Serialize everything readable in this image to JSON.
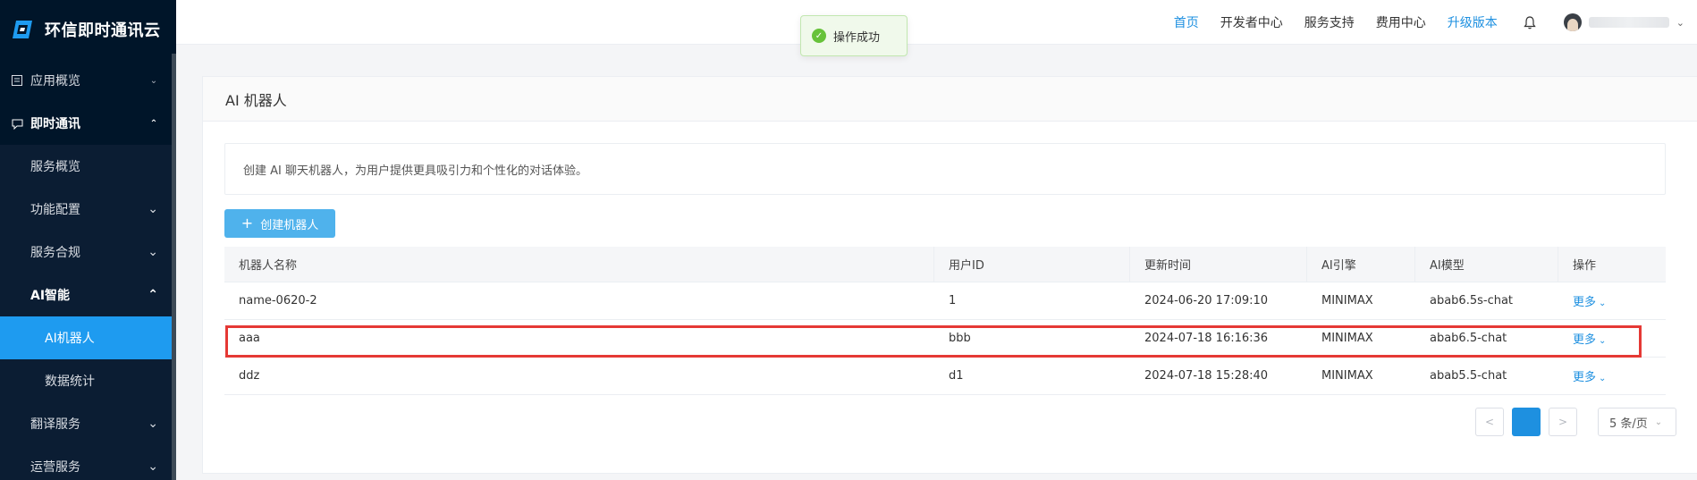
{
  "brand": {
    "name": "环信即时通讯云"
  },
  "sidebar": {
    "items": [
      {
        "label": "应用概览",
        "icon": "overview-icon",
        "state": "collapsed"
      },
      {
        "label": "即时通讯",
        "icon": "chat-icon",
        "state": "expanded"
      }
    ],
    "im_children": [
      {
        "label": "服务概览"
      },
      {
        "label": "功能配置"
      },
      {
        "label": "服务合规"
      },
      {
        "label": "AI智能"
      }
    ],
    "ai_children": [
      {
        "label": "AI机器人",
        "active": true
      },
      {
        "label": "数据统计"
      }
    ],
    "after": [
      {
        "label": "翻译服务"
      },
      {
        "label": "运营服务"
      }
    ]
  },
  "header": {
    "nav": [
      {
        "label": "首页",
        "accent": true
      },
      {
        "label": "开发者中心",
        "accent": false
      },
      {
        "label": "服务支持",
        "accent": false
      },
      {
        "label": "费用中心",
        "accent": false
      },
      {
        "label": "升级版本",
        "accent": true
      }
    ]
  },
  "toast": {
    "text": "操作成功",
    "icon": "check-circle-icon"
  },
  "card": {
    "title": "AI 机器人",
    "tip": "创建 AI 聊天机器人，为用户提供更具吸引力和个性化的对话体验。",
    "create_button": "创建机器人"
  },
  "table": {
    "columns": [
      "机器人名称",
      "用户ID",
      "更新时间",
      "AI引擎",
      "AI模型",
      "操作"
    ],
    "rows": [
      {
        "name": "name-0620-2",
        "user_id": "1",
        "updated": "2024-06-20 17:09:10",
        "engine": "MINIMAX",
        "model": "abab6.5s-chat",
        "action": "更多"
      },
      {
        "name": "aaa",
        "user_id": "bbb",
        "updated": "2024-07-18 16:16:36",
        "engine": "MINIMAX",
        "model": "abab6.5-chat",
        "action": "更多"
      },
      {
        "name": "ddz",
        "user_id": "d1",
        "updated": "2024-07-18 15:28:40",
        "engine": "MINIMAX",
        "model": "abab5.5-chat",
        "action": "更多"
      }
    ]
  },
  "pagination": {
    "current_page": "1",
    "page_size": "5 条/页",
    "prev": "<",
    "next": ">"
  },
  "colors": {
    "accent": "#1e90e0",
    "sidebar_bg": "#001529",
    "active_item": "#1e9bf0",
    "highlight": "#e53935",
    "success": "#67c23a"
  }
}
